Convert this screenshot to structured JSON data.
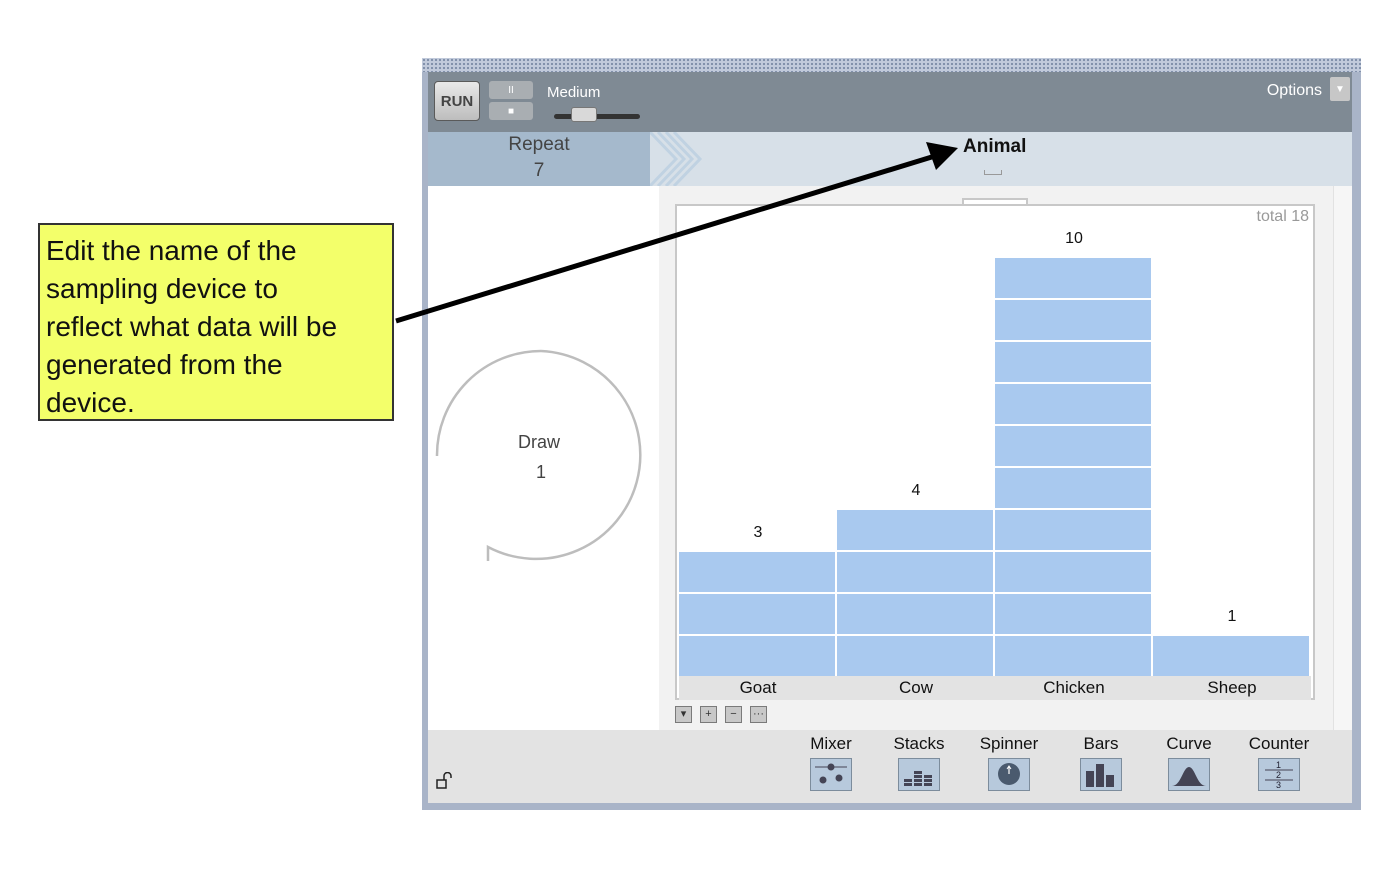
{
  "callout": {
    "lines": [
      "Edit the name of the",
      "sampling device to",
      "reflect what data will be",
      "generated from the",
      "device."
    ]
  },
  "toolbar": {
    "run_label": "RUN",
    "pause_glyph": "II",
    "stop_glyph": "■",
    "speed_label": "Medium",
    "options_label": "Options",
    "options_arrow": "▼"
  },
  "header": {
    "repeat_label": "Repeat",
    "repeat_value": "7",
    "device_name": "Animal"
  },
  "draw": {
    "label": "Draw",
    "value": "1"
  },
  "stacks": {
    "total_label": "total 18",
    "categories": [
      "Goat",
      "Cow",
      "Chicken",
      "Sheep"
    ],
    "counts": [
      3,
      4,
      10,
      1
    ],
    "count_labels": [
      "3",
      "4",
      "10",
      "1"
    ],
    "bar_color": "#a9c9ef"
  },
  "mini_controls": [
    "▾",
    "+",
    "−",
    "···"
  ],
  "footer": {
    "lock_icon": "unlocked",
    "devices": [
      "Mixer",
      "Stacks",
      "Spinner",
      "Bars",
      "Curve",
      "Counter"
    ]
  }
}
